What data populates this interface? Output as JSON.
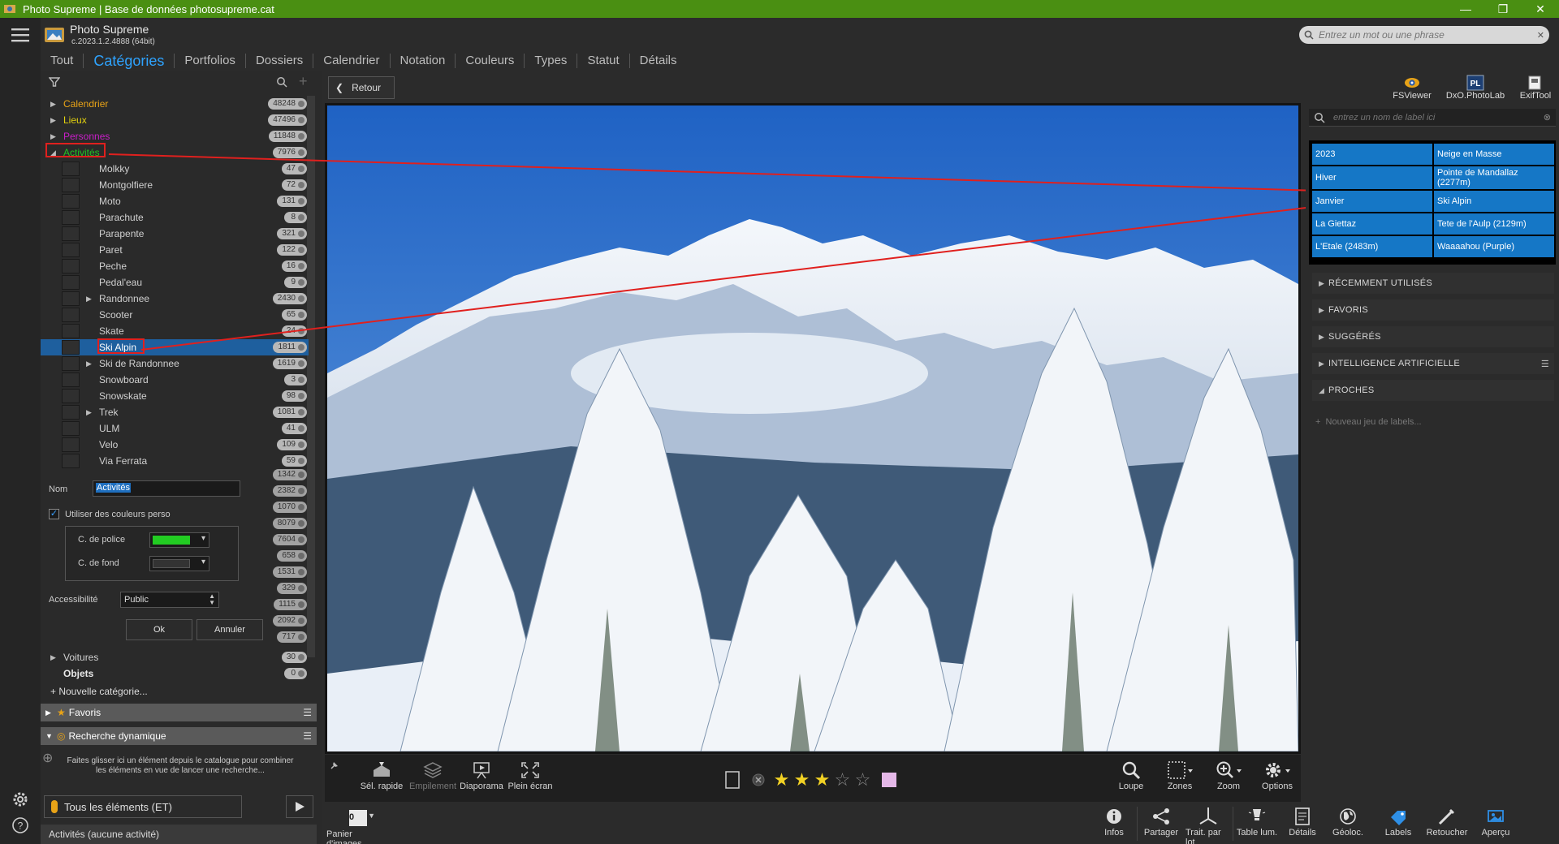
{
  "window": {
    "title": "Photo Supreme | Base de données photosupreme.cat",
    "accent": "#4a8f12"
  },
  "app": {
    "name": "Photo Supreme",
    "version": "c.2023.1.2.4888 (64bit)"
  },
  "search": {
    "placeholder": "Entrez un mot ou une phrase"
  },
  "tabs": [
    {
      "label": "Tout"
    },
    {
      "label": "Catégories"
    },
    {
      "label": "Portfolios"
    },
    {
      "label": "Dossiers"
    },
    {
      "label": "Calendrier"
    },
    {
      "label": "Notation"
    },
    {
      "label": "Couleurs"
    },
    {
      "label": "Types"
    },
    {
      "label": "Statut"
    },
    {
      "label": "Détails"
    }
  ],
  "tree": {
    "top": [
      {
        "label": "Calendrier",
        "count": "48248",
        "color": "#e8a317"
      },
      {
        "label": "Lieux",
        "count": "47496",
        "color": "#e3d20e"
      },
      {
        "label": "Personnes",
        "count": "11848",
        "color": "#c81ec8"
      },
      {
        "label": "Activités",
        "count": "7976",
        "color": "#22c322"
      }
    ],
    "children": [
      {
        "label": "Molkky",
        "count": "47"
      },
      {
        "label": "Montgolfiere",
        "count": "72"
      },
      {
        "label": "Moto",
        "count": "131"
      },
      {
        "label": "Parachute",
        "count": "8"
      },
      {
        "label": "Parapente",
        "count": "321"
      },
      {
        "label": "Paret",
        "count": "122"
      },
      {
        "label": "Peche",
        "count": "16"
      },
      {
        "label": "Pedal'eau",
        "count": "9"
      },
      {
        "label": "Randonnee",
        "count": "2430"
      },
      {
        "label": "Scooter",
        "count": "65"
      },
      {
        "label": "Skate",
        "count": "24"
      },
      {
        "label": "Ski Alpin",
        "count": "1811"
      },
      {
        "label": "Ski de Randonnee",
        "count": "1619"
      },
      {
        "label": "Snowboard",
        "count": "3"
      },
      {
        "label": "Snowskate",
        "count": "98"
      },
      {
        "label": "Trek",
        "count": "1081"
      },
      {
        "label": "ULM",
        "count": "41"
      },
      {
        "label": "Velo",
        "count": "109"
      },
      {
        "label": "Via Ferrata",
        "count": "59"
      }
    ],
    "hidden_counts": [
      "1342",
      "2382",
      "1070",
      "8079",
      "7604",
      "658",
      "1531",
      "329",
      "1115",
      "2092",
      "717"
    ],
    "after": [
      {
        "label": "Voitures",
        "count": "30"
      },
      {
        "label": "Objets",
        "count": "0"
      }
    ],
    "new_category": "Nouvelle catégorie..."
  },
  "editor": {
    "name_label": "Nom",
    "name_value": "Activités",
    "custom_colors_label": "Utiliser des couleurs perso",
    "font_color_label": "C. de police",
    "font_color": "#22cc22",
    "bg_color_label": "C. de fond",
    "bg_color": "#333333",
    "access_label": "Accessibilité",
    "access_value": "Public",
    "ok": "Ok",
    "cancel": "Annuler"
  },
  "sections": {
    "favoris": "Favoris",
    "recherche": "Recherche dynamique",
    "drop_hint": "Faites glisser ici un élément depuis le catalogue pour combiner les éléments en vue de lancer une recherche...",
    "filter_mode": "Tous les éléments (ET)",
    "status": "Activités (aucune activité)"
  },
  "center": {
    "back": "Retour",
    "toolbar": [
      {
        "label": "Sél. rapide"
      },
      {
        "label": "Empilement"
      },
      {
        "label": "Diaporama"
      },
      {
        "label": "Plein écran"
      }
    ],
    "rating": 3,
    "rating_max": 5,
    "color_tag": "#e5b8e8",
    "view_tools": [
      {
        "label": "Loupe"
      },
      {
        "label": "Zones"
      },
      {
        "label": "Zoom"
      },
      {
        "label": "Options"
      }
    ],
    "basket_count": "0",
    "basket_label": "Panier d'images"
  },
  "bottom_tools": [
    {
      "label": "Infos"
    },
    {
      "label": "Partager"
    },
    {
      "label": "Trait. par lot"
    },
    {
      "label": "Table lum."
    },
    {
      "label": "Détails"
    },
    {
      "label": "Géoloc."
    },
    {
      "label": "Labels"
    },
    {
      "label": "Retoucher"
    },
    {
      "label": "Aperçu"
    }
  ],
  "right": {
    "top_tools": [
      {
        "label": "FSViewer"
      },
      {
        "label": "DxO.PhotoLab"
      },
      {
        "label": "ExifTool"
      }
    ],
    "label_search_placeholder": "entrez un nom de label ici",
    "labels": [
      "2023",
      "Neige en Masse",
      "Hiver",
      "Pointe de Mandallaz (2277m)",
      "Janvier",
      "Ski Alpin",
      "La Giettaz",
      "Tete de l'Aulp (2129m)",
      "L'Etale (2483m)",
      "Waaaahou (Purple)"
    ],
    "sections": [
      "RÉCEMMENT UTILISÉS",
      "FAVORIS",
      "SUGGÉRÉS",
      "INTELLIGENCE ARTIFICIELLE",
      "PROCHES"
    ],
    "new_label_set": "Nouveau jeu de labels..."
  }
}
